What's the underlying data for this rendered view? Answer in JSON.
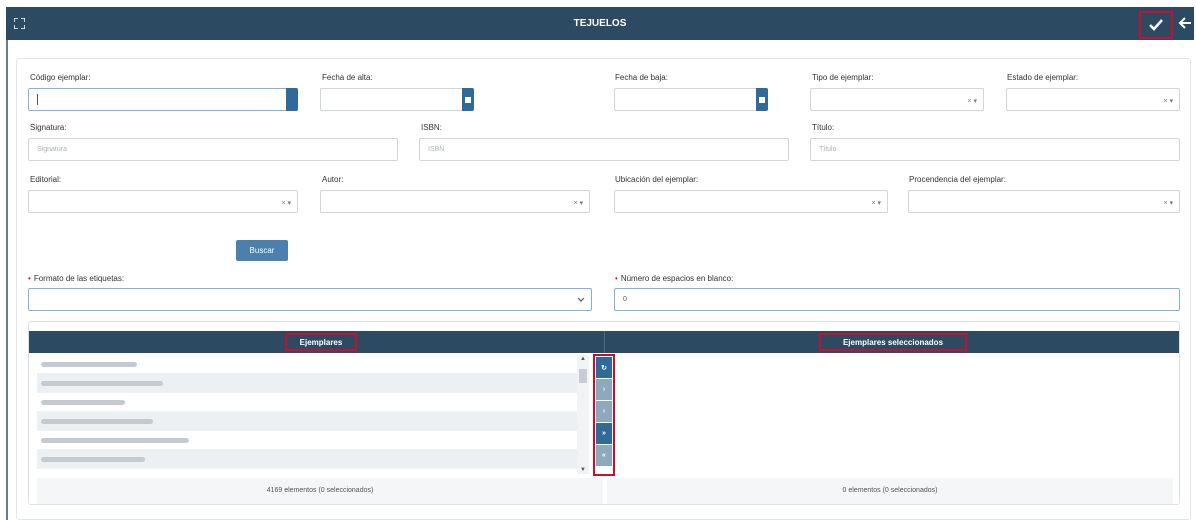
{
  "header": {
    "title": "TEJUELOS",
    "expand_icon": "expand-icon",
    "confirm_icon": "check-icon",
    "back_icon": "arrow-left-icon"
  },
  "filters": {
    "codigo_ejemplar": {
      "label": "Código ejemplar:",
      "value": ""
    },
    "fecha_alta": {
      "label": "Fecha de alta:",
      "value": ""
    },
    "fecha_baja": {
      "label": "Fecha de baja:",
      "value": ""
    },
    "tipo_ejemplar": {
      "label": "Tipo de ejemplar:",
      "value": ""
    },
    "estado_ejemplar": {
      "label": "Estado de ejemplar:",
      "value": ""
    },
    "signatura": {
      "label": "Signatura:",
      "placeholder": "Signatura"
    },
    "isbn": {
      "label": "ISBN:",
      "placeholder": "ISBN"
    },
    "titulo": {
      "label": "Título:",
      "placeholder": "Título"
    },
    "editorial": {
      "label": "Editorial:",
      "value": ""
    },
    "autor": {
      "label": "Autor:",
      "value": ""
    },
    "ubicacion": {
      "label": "Ubicación del ejemplar:",
      "value": ""
    },
    "procedencia": {
      "label": "Procendencia del ejemplar:",
      "value": ""
    },
    "clear_glyph": "× ▾",
    "search_button": "Buscar"
  },
  "options": {
    "formato": {
      "label": "Formato de las etiquetas:",
      "value": ""
    },
    "espacios": {
      "label": "Número de espacios en blanco:",
      "value": "0"
    },
    "required_mark": "•"
  },
  "selector": {
    "left_title": "Ejemplares",
    "right_title": "Ejemplares seleccionados",
    "left_footer": "4169 elementos (0 seleccionados)",
    "right_footer": "0 elementos (0 seleccionados)",
    "controls": [
      "↻",
      "›",
      "‹",
      "»",
      "«"
    ]
  },
  "colors": {
    "header_bg": "#2d4a63",
    "highlight": "#c8102e",
    "accent": "#2f6a98"
  }
}
